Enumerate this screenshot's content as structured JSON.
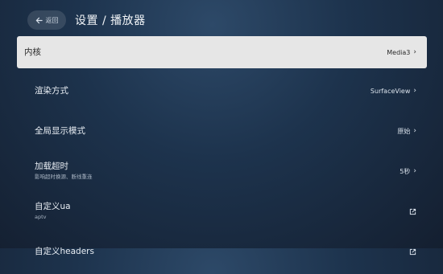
{
  "header": {
    "back_label": "返回",
    "title": "设置 / 播放器"
  },
  "rows": [
    {
      "label": "内核",
      "value": "Media3",
      "icon": "chevron-right-icon",
      "selected": true
    },
    {
      "label": "渲染方式",
      "value": "SurfaceView",
      "icon": "chevron-right-icon"
    },
    {
      "label": "全局显示模式",
      "value": "原始",
      "icon": "chevron-right-icon"
    },
    {
      "label": "加载超时",
      "sublabel": "影响超时换源、断线重连",
      "value": "5秒",
      "icon": "chevron-right-icon"
    },
    {
      "label": "自定义ua",
      "sublabel": "aptv",
      "icon": "open-in-new-icon"
    },
    {
      "label": "自定义headers",
      "icon": "open-in-new-icon"
    }
  ]
}
